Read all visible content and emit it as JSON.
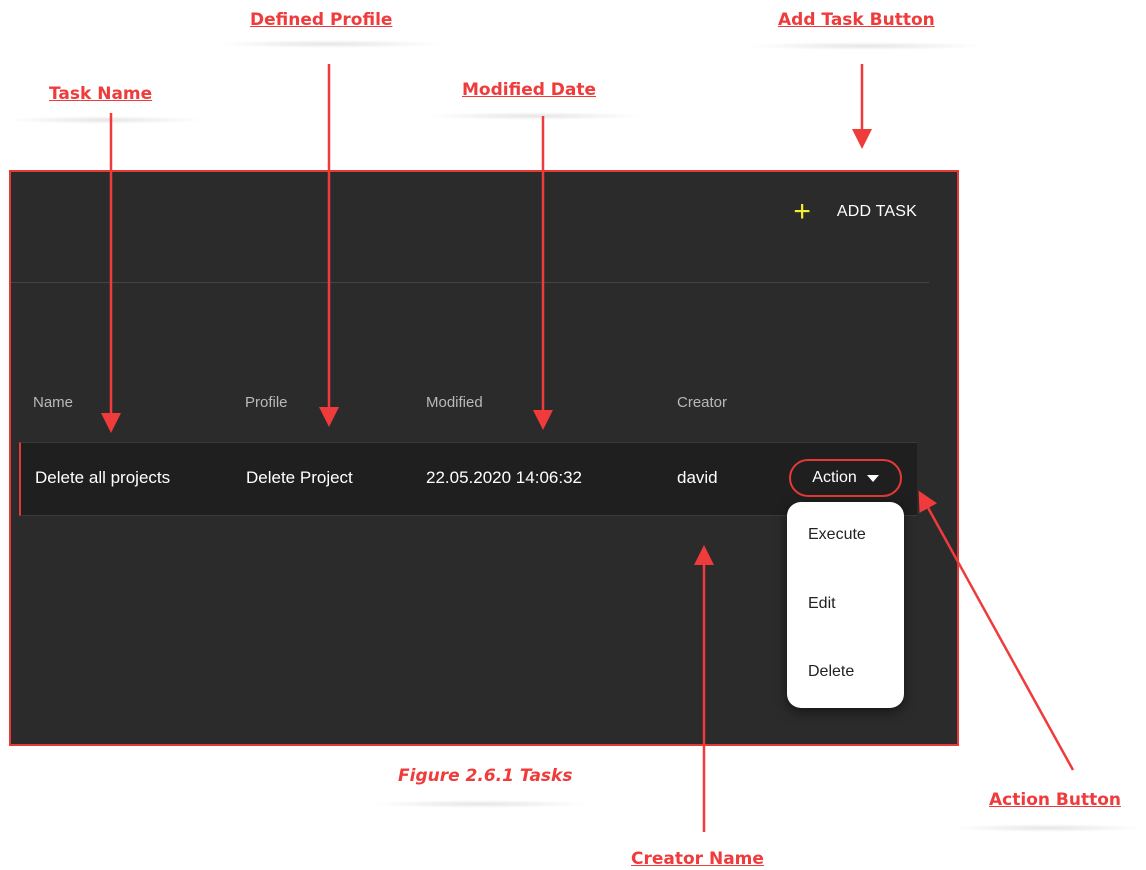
{
  "annotations": {
    "defined_profile": "Defined Profile",
    "add_task_button": "Add Task Button",
    "task_name": "Task Name",
    "modified_date": "Modified Date",
    "action_button": "Action Button",
    "creator_name": "Creator Name"
  },
  "caption": "Figure 2.6.1 Tasks",
  "toolbar": {
    "add_task_label": "ADD TASK"
  },
  "table": {
    "headers": [
      "Name",
      "Profile",
      "Modified",
      "Creator"
    ],
    "rows": [
      {
        "name": "Delete all projects",
        "profile": "Delete Project",
        "modified": "22.05.2020 14:06:32",
        "creator": "david",
        "action_label": "Action"
      }
    ]
  },
  "action_menu": {
    "items": [
      "Execute",
      "Edit",
      "Delete"
    ]
  },
  "colors": {
    "panel_bg": "#2b2b2b",
    "annotation_red": "#ef3b3b",
    "plus_yellow": "#f5ee30"
  },
  "icons": {
    "add": "plus-icon",
    "dropdown": "caret-down-icon"
  }
}
